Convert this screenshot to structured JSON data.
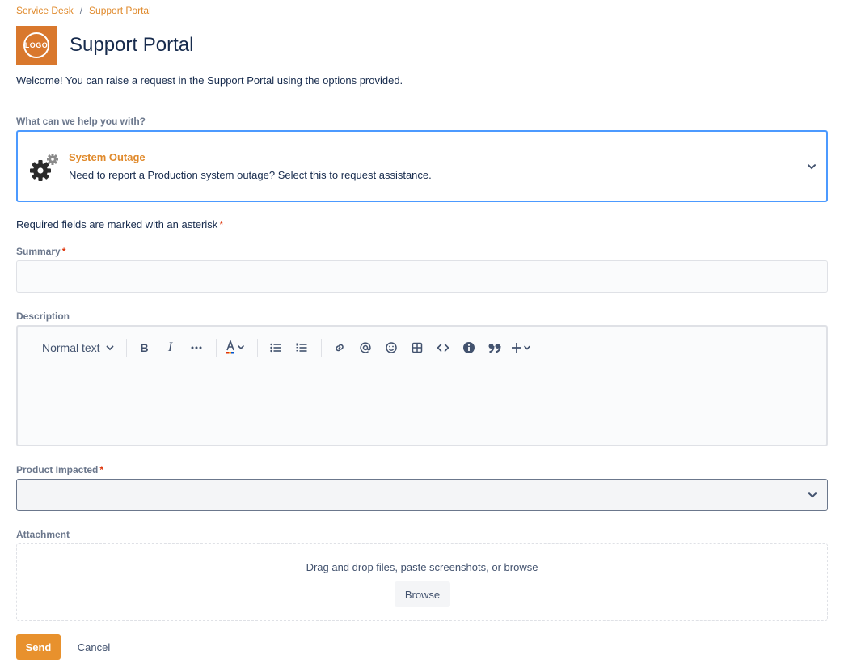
{
  "breadcrumb": {
    "items": [
      "Service Desk",
      "Support Portal"
    ],
    "separator": "/"
  },
  "header": {
    "logo_text": "LOGO",
    "title": "Support Portal",
    "welcome": "Welcome! You can raise a request in the Support Portal using the options provided."
  },
  "request_type": {
    "label": "What can we help you with?",
    "title": "System Outage",
    "description": "Need to report a Production system outage? Select this to request assistance.",
    "icon": "gears-icon"
  },
  "required_note": "Required fields are marked with an asterisk",
  "required_marker": "*",
  "summary": {
    "label": "Summary",
    "value": ""
  },
  "description": {
    "label": "Description",
    "text_style": "Normal text",
    "toolbar_icons": [
      "bold-icon",
      "italic-icon",
      "more-icon",
      "text-color-icon",
      "bullet-list-icon",
      "numbered-list-icon",
      "link-icon",
      "mention-icon",
      "emoji-icon",
      "table-icon",
      "code-icon",
      "info-icon",
      "quote-icon",
      "insert-icon"
    ],
    "bold_glyph": "B",
    "italic_glyph": "I"
  },
  "product": {
    "label": "Product Impacted",
    "value": ""
  },
  "attachment": {
    "label": "Attachment",
    "hint": "Drag and drop files, paste screenshots, or browse",
    "browse_label": "Browse"
  },
  "actions": {
    "send_label": "Send",
    "cancel_label": "Cancel"
  },
  "colors": {
    "accent": "#e08a2c",
    "focus": "#4c9aff",
    "required": "#de350b"
  }
}
